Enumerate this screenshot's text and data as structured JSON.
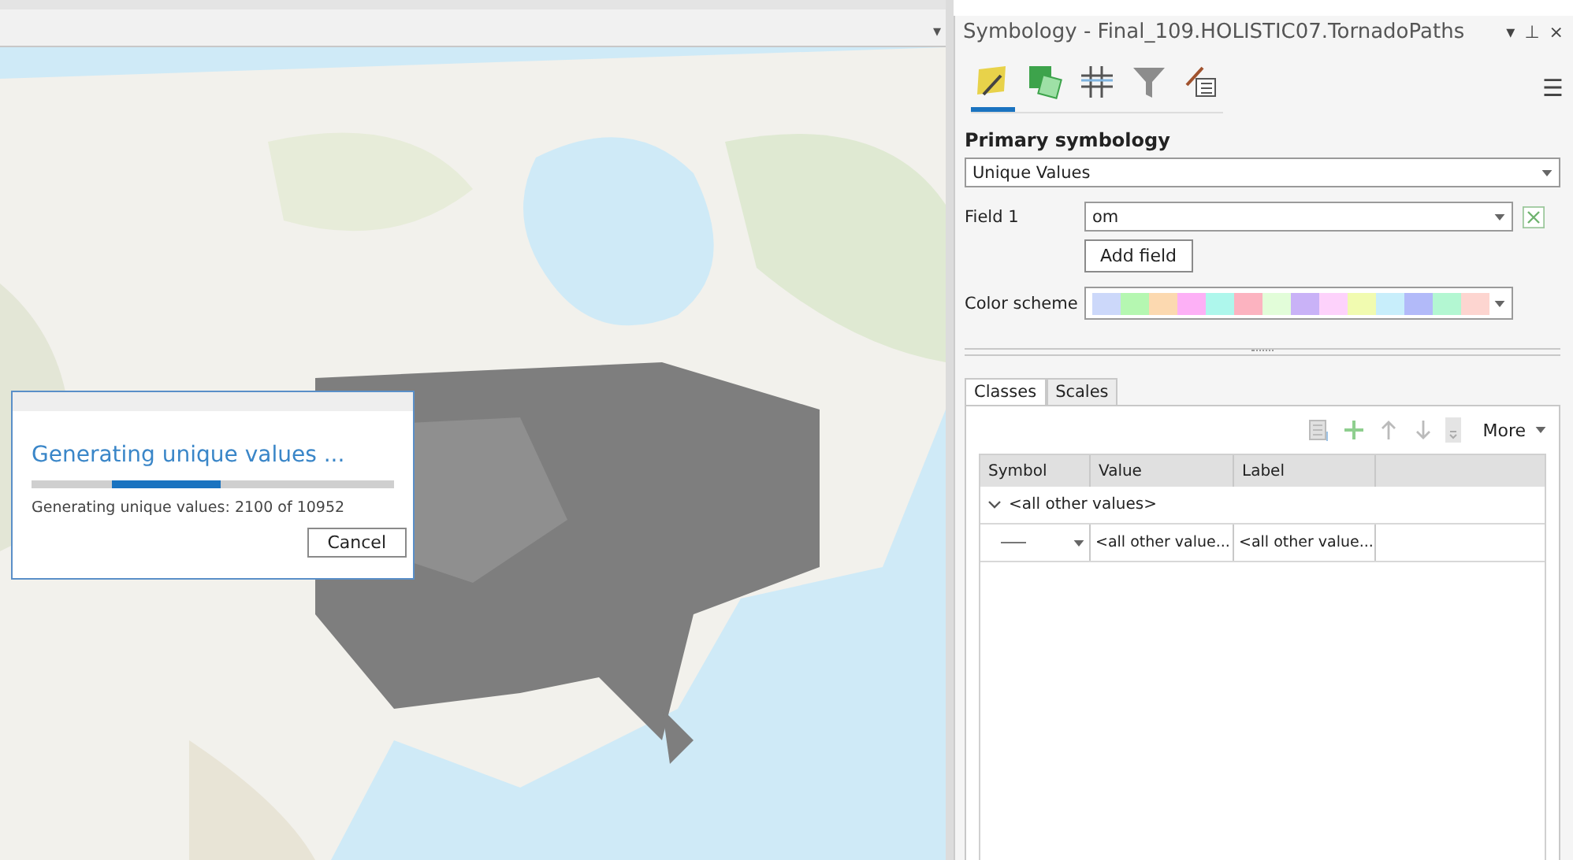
{
  "view": {
    "menu_caret": "▾"
  },
  "dialog": {
    "title": "Generating unique values ...",
    "progress": {
      "level": 0.3
    },
    "message": "Generating unique values: 2100 of 10952",
    "button": "Cancel"
  },
  "pane": {
    "title": "Symbology - Final_109.HOLISTIC07.TornadoPaths",
    "controls": [
      "▾",
      "⊥",
      "×"
    ],
    "tool_tabs": [
      {
        "kind": "brush",
        "selected": true
      },
      {
        "kind": "layers",
        "selected": false
      },
      {
        "kind": "grid",
        "selected": false
      },
      {
        "kind": "filter",
        "selected": false
      },
      {
        "kind": "list",
        "selected": false
      }
    ],
    "menu_icon": "☰",
    "primary_label": "Primary symbology",
    "primary_value": "Unique Values",
    "field_label": "Field 1",
    "field_value": "om",
    "add_field": "Add field",
    "scheme_label": "Color scheme",
    "swatches": [
      {
        "color": "#ccd8fa"
      },
      {
        "color": "#b5f7b1"
      },
      {
        "color": "#fcd9b0"
      },
      {
        "color": "#fdb0f6"
      },
      {
        "color": "#aef7ec"
      },
      {
        "color": "#fcb3c0"
      },
      {
        "color": "#e2fdd9"
      },
      {
        "color": "#c9b2f7"
      },
      {
        "color": "#fdd2fb"
      },
      {
        "color": "#f1fbb0"
      },
      {
        "color": "#c8eefb"
      },
      {
        "color": "#b2baf9"
      },
      {
        "color": "#b3f7d2"
      },
      {
        "color": "#fdd5d0"
      }
    ],
    "tabs": [
      {
        "label": "Classes",
        "selected": true
      },
      {
        "label": "Scales",
        "selected": false
      }
    ],
    "more": "More",
    "table": {
      "columns": [
        "Symbol",
        "Value",
        "Label"
      ],
      "groups": [
        {
          "label": "<all other values>",
          "expanded": true,
          "rows": [
            {
              "value": "<all other value...",
              "label": "<all other value..."
            }
          ]
        }
      ]
    }
  }
}
